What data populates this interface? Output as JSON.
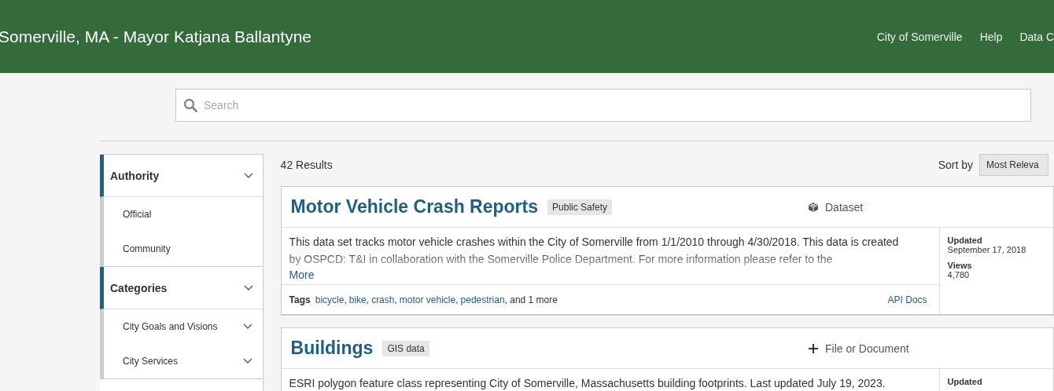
{
  "header": {
    "title": "Somerville, MA - Mayor Katjana Ballantyne",
    "nav": [
      "City of Somerville",
      "Help",
      "Data C"
    ]
  },
  "search": {
    "placeholder": "Search"
  },
  "sidebar": {
    "sections": [
      {
        "title": "Authority",
        "expanded": true,
        "items": [
          {
            "label": "Official",
            "expandable": false
          },
          {
            "label": "Community",
            "expandable": false
          }
        ]
      },
      {
        "title": "Categories",
        "expanded": true,
        "items": [
          {
            "label": "City Goals and Visions",
            "expandable": true
          },
          {
            "label": "City Services",
            "expandable": true
          }
        ]
      }
    ]
  },
  "results": {
    "count": "42 Results",
    "sort_label": "Sort by",
    "sort_value": "Most Releva",
    "items": [
      {
        "title": "Motor Vehicle Crash Reports",
        "category": "Public Safety",
        "type": "Dataset",
        "kind": "dataset",
        "description": "This data set tracks motor vehicle crashes within the City of Somerville from 1/1/2010 through 4/30/2018. This data is created by OSPCD: T&I in collaboration with the Somerville Police Department. For more information please refer to the",
        "more": "More",
        "tags_label": "Tags",
        "tag_separator": ",",
        "tags": [
          "bicycle",
          "bike",
          "crash",
          "motor vehicle",
          "pedestrian"
        ],
        "tags_more": ", and 1 more",
        "api": "API Docs",
        "meta": [
          {
            "label": "Updated",
            "value": "September 17, 2018"
          },
          {
            "label": "Views",
            "value": "4,780"
          }
        ]
      },
      {
        "title": "Buildings",
        "category": "GIS data",
        "type": "File or Document",
        "kind": "file",
        "description": "ESRI polygon feature class representing City of Somerville, Massachusetts building footprints. Last updated July 19, 2023.",
        "meta": [
          {
            "label": "Updated"
          }
        ]
      }
    ]
  }
}
